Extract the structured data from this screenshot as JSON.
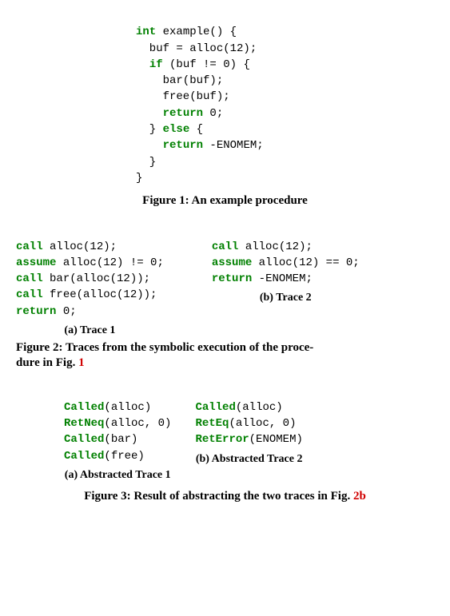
{
  "fig1": {
    "code": {
      "l1": {
        "kw": "int",
        "rest": " example() {"
      },
      "l2": "  buf = alloc(12);",
      "l3": {
        "kw": "if",
        "rest": " (buf != 0) {"
      },
      "l4": "    bar(buf);",
      "l5": "    free(buf);",
      "l6": {
        "kw": "return",
        "rest": " 0;"
      },
      "l7": {
        "lead": "  } ",
        "kw": "else",
        "rest": " {"
      },
      "l8": {
        "kw": "return",
        "rest": " -ENOMEM;"
      },
      "l9": "  }",
      "l10": "}"
    },
    "caption": "Figure 1: An example procedure"
  },
  "fig2": {
    "trace1": {
      "l1": {
        "kw": "call",
        "rest": " alloc(12);"
      },
      "l2": {
        "kw": "assume",
        "rest": " alloc(12) != 0;"
      },
      "l3": {
        "kw": "call",
        "rest": " bar(alloc(12));"
      },
      "l4": {
        "kw": "call",
        "rest": " free(alloc(12));"
      },
      "l5": {
        "kw": "return",
        "rest": " 0;"
      },
      "subcap": "(a) Trace 1"
    },
    "trace2": {
      "l1": {
        "kw": "call",
        "rest": " alloc(12);"
      },
      "l2": {
        "kw": "assume",
        "rest": " alloc(12) == 0;"
      },
      "l3": {
        "kw": "return",
        "rest": " -ENOMEM;"
      },
      "subcap": "(b) Trace 2"
    },
    "caption_prefix": "Figure 2: Traces from the symbolic execution of the proce-",
    "caption_line2_a": "dure in Fig. ",
    "caption_ref": "1"
  },
  "fig3": {
    "abst1": {
      "l1": {
        "pred": "Called",
        "rest": "(alloc)"
      },
      "l2": {
        "pred": "RetNeq",
        "rest": "(alloc, 0)"
      },
      "l3": {
        "pred": "Called",
        "rest": "(bar)"
      },
      "l4": {
        "pred": "Called",
        "rest": "(free)"
      },
      "subcap": "(a) Abstracted Trace 1"
    },
    "abst2": {
      "l1": {
        "pred": "Called",
        "rest": "(alloc)"
      },
      "l2": {
        "pred": "RetEq",
        "rest": "(alloc, 0)"
      },
      "l3": {
        "pred": "RetError",
        "rest": "(ENOMEM)"
      },
      "subcap": "(b) Abstracted Trace 2"
    },
    "caption_a": "Figure 3: Result of abstracting the two traces in Fig. ",
    "caption_ref": "2b"
  }
}
